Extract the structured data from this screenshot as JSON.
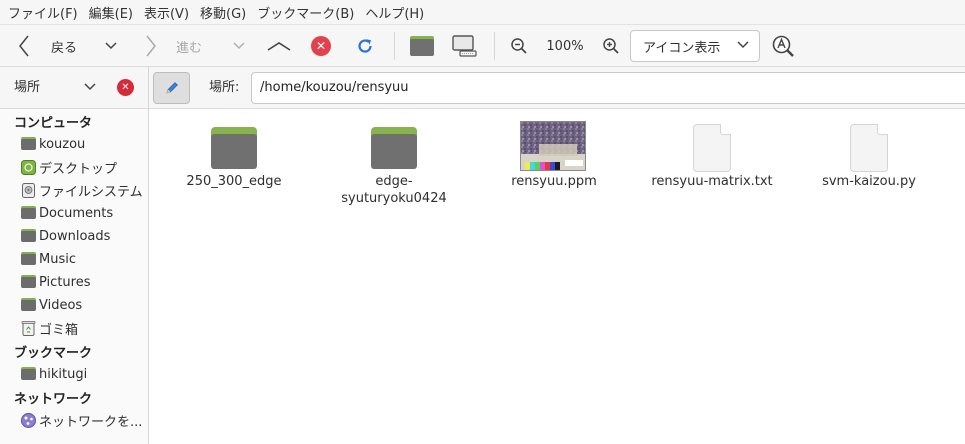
{
  "menu": [
    "ファイル(F)",
    "編集(E)",
    "表示(V)",
    "移動(G)",
    "ブックマーク(B)",
    "ヘルプ(H)"
  ],
  "toolbar": {
    "back_label": "戻る",
    "forward_label": "進む",
    "zoom_level": "100%",
    "view_mode": "アイコン表示"
  },
  "places": {
    "label": "場所"
  },
  "location": {
    "label": "場所:",
    "path": "/home/kouzou/rensyuu"
  },
  "sidebar": {
    "computer_title": "コンピュータ",
    "computer_items": [
      {
        "label": "kouzou",
        "icon": "folder-icon"
      },
      {
        "label": "デスクトップ",
        "icon": "desktop-icon"
      },
      {
        "label": "ファイルシステム",
        "icon": "filesystem-icon"
      },
      {
        "label": "Documents",
        "icon": "folder-icon"
      },
      {
        "label": "Downloads",
        "icon": "folder-icon"
      },
      {
        "label": "Music",
        "icon": "folder-icon"
      },
      {
        "label": "Pictures",
        "icon": "folder-icon"
      },
      {
        "label": "Videos",
        "icon": "folder-icon"
      },
      {
        "label": "ゴミ箱",
        "icon": "trash-icon"
      }
    ],
    "bookmarks_title": "ブックマーク",
    "bookmark_items": [
      {
        "label": "hikitugi",
        "icon": "folder-icon"
      }
    ],
    "network_title": "ネットワーク",
    "network_items": [
      {
        "label": "ネットワークを...",
        "icon": "network-icon"
      }
    ]
  },
  "files": [
    {
      "name": "250_300_edge",
      "type": "folder"
    },
    {
      "name": "edge-syuturyoku0424",
      "type": "folder",
      "line1": "edge-",
      "line2": "syuturyoku0424"
    },
    {
      "name": "rensyuu.ppm",
      "type": "image"
    },
    {
      "name": "rensyuu-matrix.txt",
      "type": "text"
    },
    {
      "name": "svm-kaizou.py",
      "type": "text"
    }
  ],
  "colors": {
    "folder_tab": "#86b34c",
    "folder_body": "#707070",
    "close_red": "#e2424d"
  }
}
